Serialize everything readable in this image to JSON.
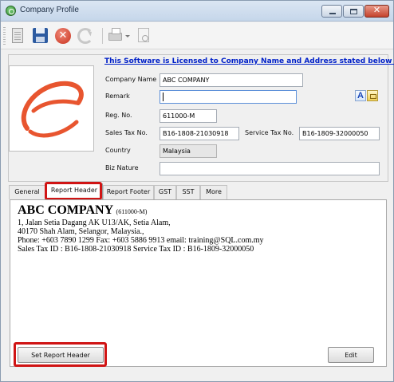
{
  "window": {
    "title": "Company Profile"
  },
  "license_text": "This Software is Licensed to Company Name and Address stated below :-",
  "form": {
    "company_name": {
      "label": "Company Name",
      "value": "ABC COMPANY"
    },
    "remark": {
      "label": "Remark",
      "value": ""
    },
    "reg_no": {
      "label": "Reg. No.",
      "value": "611000-M"
    },
    "sales_tax_no": {
      "label": "Sales Tax No.",
      "value": "B16-1808-21030918"
    },
    "service_tax_no": {
      "label": "Service Tax No.",
      "value": "B16-1809-32000050"
    },
    "country": {
      "label": "Country",
      "value": "Malaysia"
    },
    "biz_nature": {
      "label": "Biz Nature",
      "value": ""
    }
  },
  "tabs": [
    {
      "label": "General",
      "active": false
    },
    {
      "label": "Report Header",
      "active": true
    },
    {
      "label": "Report Footer",
      "active": false
    },
    {
      "label": "GST",
      "active": false
    },
    {
      "label": "SST",
      "active": false
    },
    {
      "label": "More",
      "active": false
    }
  ],
  "report_header": {
    "company": "ABC COMPANY",
    "reg": "(611000-M)",
    "address1": "1, Jalan Setia Dagang AK U13/AK, Setia Alam,",
    "address2": "40170 Shah Alam, Selangor, Malaysia.,",
    "contact": "Phone: +603 7890 1299   Fax: +603 5886 9913   email: training@SQL.com.my",
    "tax_ids": "Sales Tax ID : B16-1808-21030918   Service Tax ID : B16-1809-32000050"
  },
  "buttons": {
    "set_report_header": "Set Report Header",
    "edit": "Edit"
  },
  "icons": {
    "app": "app-icon",
    "new": "new-document-icon",
    "save": "save-disk-icon",
    "cancel": "cancel-icon",
    "refresh": "refresh-icon",
    "print": "printer-icon",
    "preview": "print-preview-icon"
  },
  "colors": {
    "highlight": "#d01414",
    "link": "#0020c8",
    "logo": "#e8552f"
  }
}
